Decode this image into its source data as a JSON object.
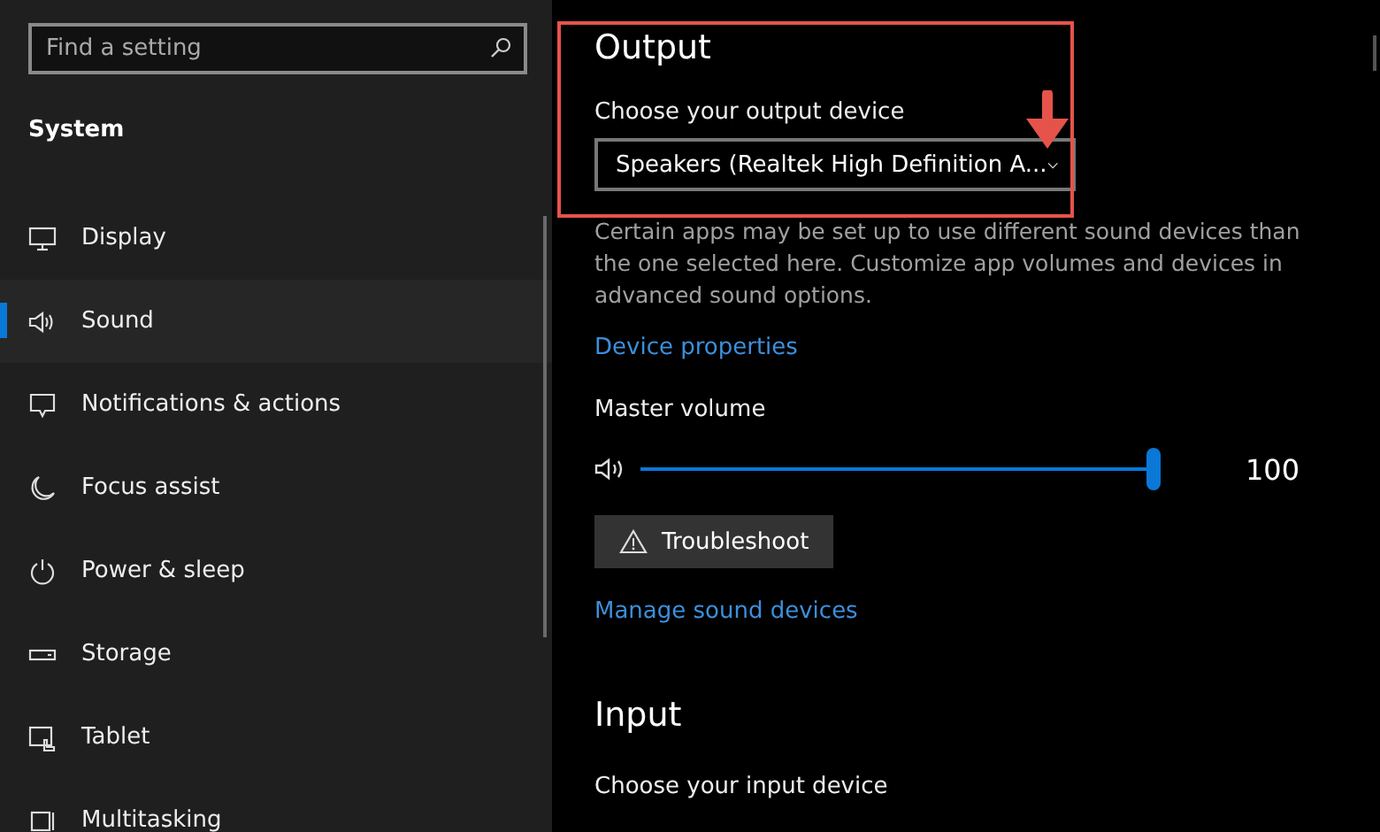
{
  "sidebar": {
    "search": {
      "placeholder": "Find a setting"
    },
    "section": "System",
    "items": [
      {
        "label": "Display",
        "selected": false
      },
      {
        "label": "Sound",
        "selected": true
      },
      {
        "label": "Notifications & actions",
        "selected": false
      },
      {
        "label": "Focus assist",
        "selected": false
      },
      {
        "label": "Power & sleep",
        "selected": false
      },
      {
        "label": "Storage",
        "selected": false
      },
      {
        "label": "Tablet",
        "selected": false
      },
      {
        "label": "Multitasking",
        "selected": false
      }
    ]
  },
  "output": {
    "heading": "Output",
    "device_label": "Choose your output device",
    "device_value": "Speakers (Realtek High Definition A...",
    "description": "Certain apps may be set up to use different sound devices than the one selected here. Customize app volumes and devices in advanced sound options.",
    "properties_link": "Device properties",
    "volume_label": "Master volume",
    "volume": {
      "level": 1.0,
      "reading": "100"
    },
    "troubleshoot_button": "Troubleshoot",
    "manage_link": "Manage sound devices"
  },
  "input": {
    "heading": "Input",
    "device_label": "Choose your input device"
  }
}
